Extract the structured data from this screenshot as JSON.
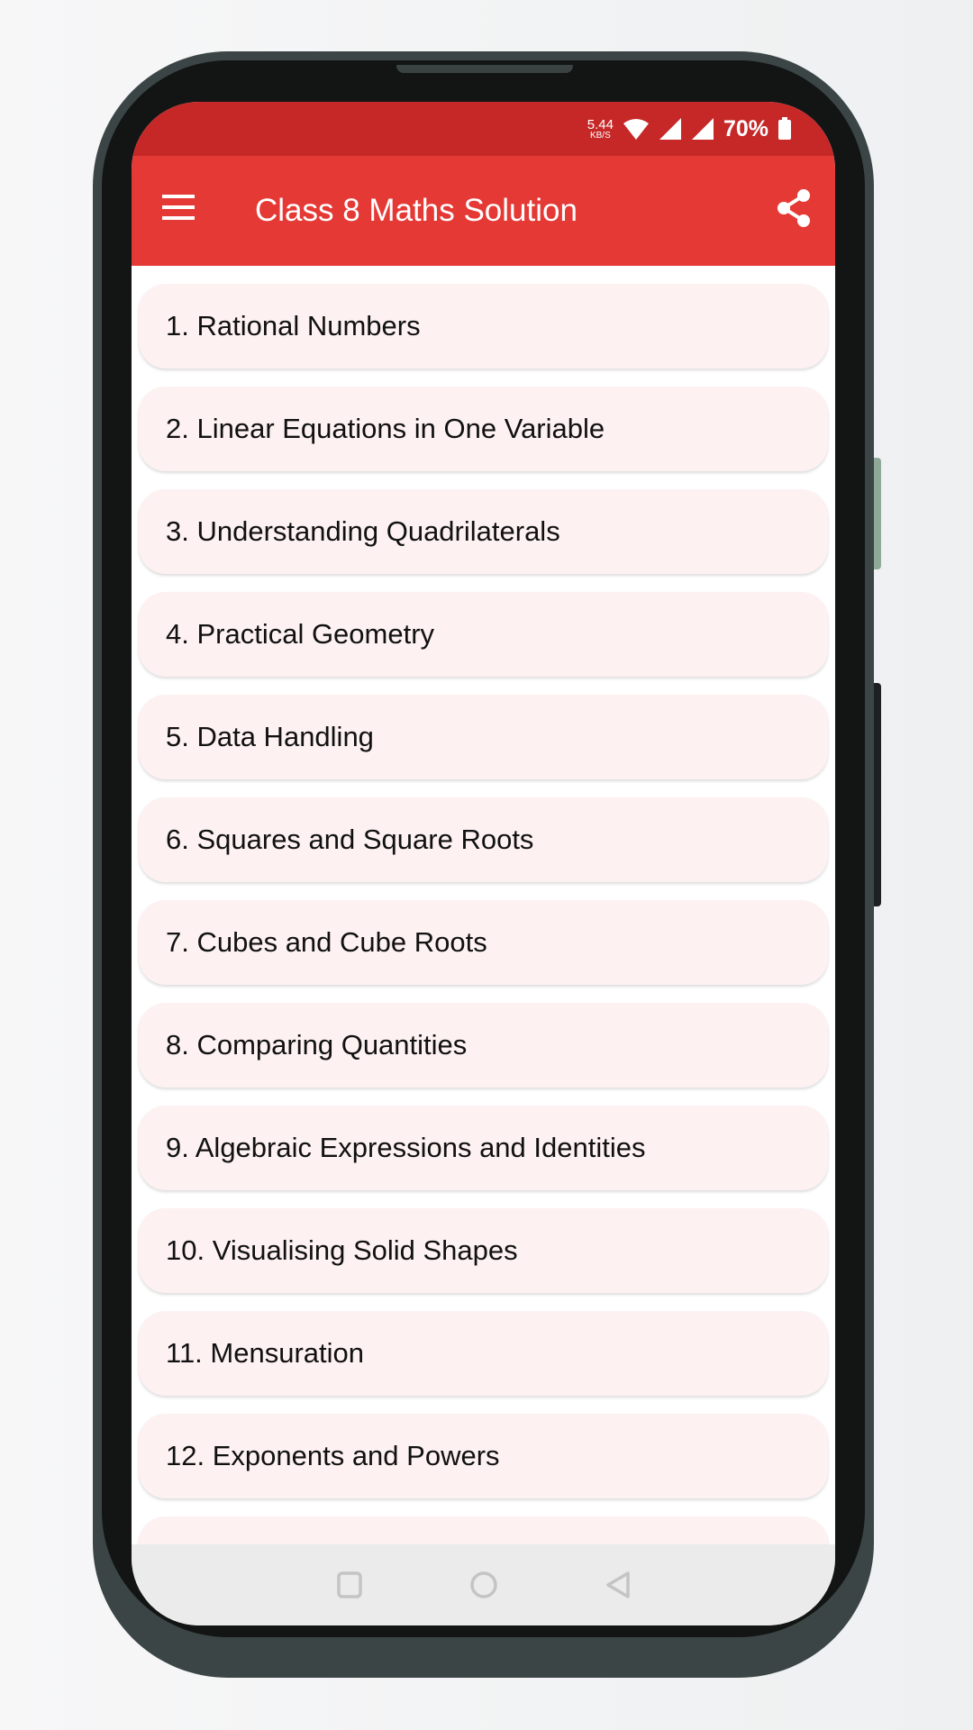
{
  "status_bar": {
    "speed_value": "5.44",
    "speed_unit": "KB/S",
    "battery": "70%",
    "icons": [
      "wifi-icon",
      "signal-icon",
      "signal-icon",
      "battery-icon"
    ]
  },
  "app_bar": {
    "title": "Class 8 Maths Solution",
    "menu_icon": "hamburger-menu-icon",
    "share_icon": "share-icon"
  },
  "chapters": [
    "1. Rational Numbers",
    "2. Linear Equations in One Variable",
    "3. Understanding Quadrilaterals",
    "4. Practical Geometry",
    "5. Data Handling",
    "6. Squares and Square Roots",
    "7. Cubes and Cube Roots",
    "8. Comparing Quantities",
    "9. Algebraic Expressions and Identities",
    "10. Visualising Solid Shapes",
    "11. Mensuration",
    "12. Exponents and Powers",
    ""
  ],
  "colors": {
    "status_bar": "#c62828",
    "app_bar": "#e53935",
    "item_bg": "#fdf1f1",
    "nav_bar": "#ebebeb"
  },
  "nav_bar": {
    "icons": [
      "recents-icon",
      "home-icon",
      "back-icon"
    ]
  }
}
